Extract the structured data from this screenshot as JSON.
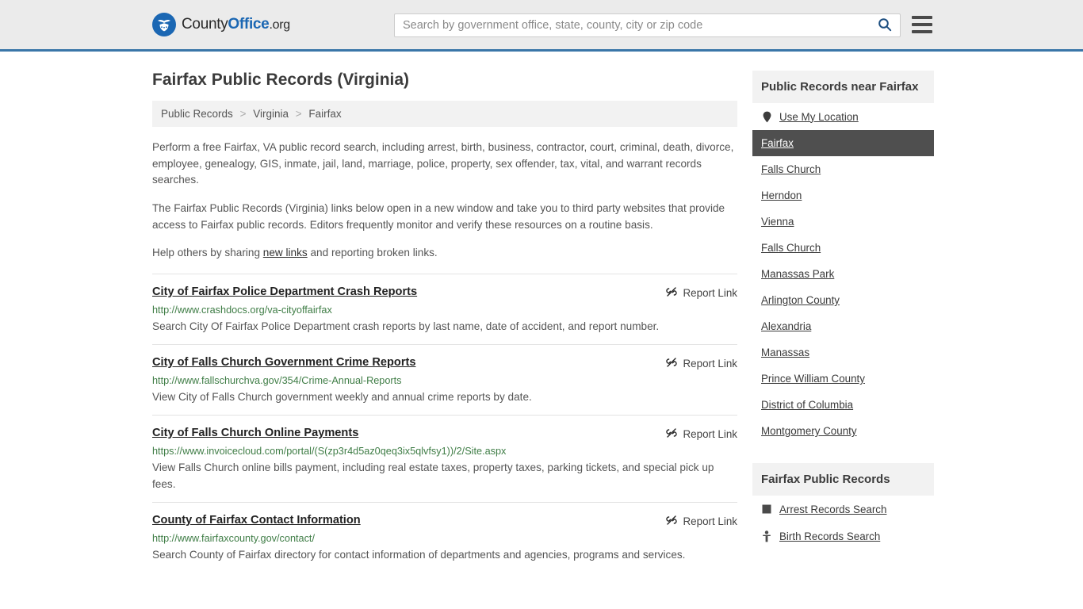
{
  "header": {
    "logo": {
      "part1": "County",
      "part2": "Office",
      "part3": ".org",
      "icon": "eagle-shield-icon"
    },
    "search": {
      "placeholder": "Search by government office, state, county, city or zip code",
      "value": "",
      "icon": "search-icon"
    },
    "menu_icon": "hamburger-menu-icon",
    "accent_color": "#3a76a8",
    "background_color": "#ebebeb"
  },
  "main": {
    "title": "Fairfax Public Records (Virginia)",
    "breadcrumb": [
      {
        "label": "Public Records"
      },
      {
        "label": "Virginia"
      },
      {
        "label": "Fairfax"
      }
    ],
    "breadcrumb_separator": ">",
    "paragraphs": {
      "p1": "Perform a free Fairfax, VA public record search, including arrest, birth, business, contractor, court, criminal, death, divorce, employee, genealogy, GIS, inmate, jail, land, marriage, police, property, sex offender, tax, vital, and warrant records searches.",
      "p2": "The Fairfax Public Records (Virginia) links below open in a new window and take you to third party websites that provide access to Fairfax public records. Editors frequently monitor and verify these resources on a routine basis.",
      "p3_before": "Help others by sharing ",
      "p3_link": "new links",
      "p3_after": " and reporting broken links."
    },
    "report_link_label": "Report Link",
    "report_link_icon": "broken-link-icon",
    "results": [
      {
        "title": "City of Fairfax Police Department Crash Reports",
        "url": "http://www.crashdocs.org/va-cityoffairfax",
        "description": "Search City Of Fairfax Police Department crash reports by last name, date of accident, and report number."
      },
      {
        "title": "City of Falls Church Government Crime Reports",
        "url": "http://www.fallschurchva.gov/354/Crime-Annual-Reports",
        "description": "View City of Falls Church government weekly and annual crime reports by date."
      },
      {
        "title": "City of Falls Church Online Payments",
        "url": "https://www.invoicecloud.com/portal/(S(zp3r4d5az0qeq3ix5qlvfsy1))/2/Site.aspx",
        "description": "View Falls Church online bills payment, including real estate taxes, property taxes, parking tickets, and special pick up fees."
      },
      {
        "title": "County of Fairfax Contact Information",
        "url": "http://www.fairfaxcounty.gov/contact/",
        "description": "Search County of Fairfax directory for contact information of departments and agencies, programs and services."
      }
    ]
  },
  "sidebar": {
    "nearby": {
      "heading": "Public Records near Fairfax",
      "items": [
        {
          "label": "Use My Location",
          "icon": "map-pin-icon",
          "active": false
        },
        {
          "label": "Fairfax",
          "icon": "",
          "active": true
        },
        {
          "label": "Falls Church",
          "icon": "",
          "active": false
        },
        {
          "label": "Herndon",
          "icon": "",
          "active": false
        },
        {
          "label": "Vienna",
          "icon": "",
          "active": false
        },
        {
          "label": "Falls Church",
          "icon": "",
          "active": false
        },
        {
          "label": "Manassas Park",
          "icon": "",
          "active": false
        },
        {
          "label": "Arlington County",
          "icon": "",
          "active": false
        },
        {
          "label": "Alexandria",
          "icon": "",
          "active": false
        },
        {
          "label": "Manassas",
          "icon": "",
          "active": false
        },
        {
          "label": "Prince William County",
          "icon": "",
          "active": false
        },
        {
          "label": "District of Columbia",
          "icon": "",
          "active": false
        },
        {
          "label": "Montgomery County",
          "icon": "",
          "active": false
        }
      ]
    },
    "records": {
      "heading": "Fairfax Public Records",
      "items": [
        {
          "label": "Arrest Records Search",
          "icon": "fingerprint-card-icon"
        },
        {
          "label": "Birth Records Search",
          "icon": "baby-icon"
        }
      ]
    },
    "active_background": "#4f4f4f"
  }
}
